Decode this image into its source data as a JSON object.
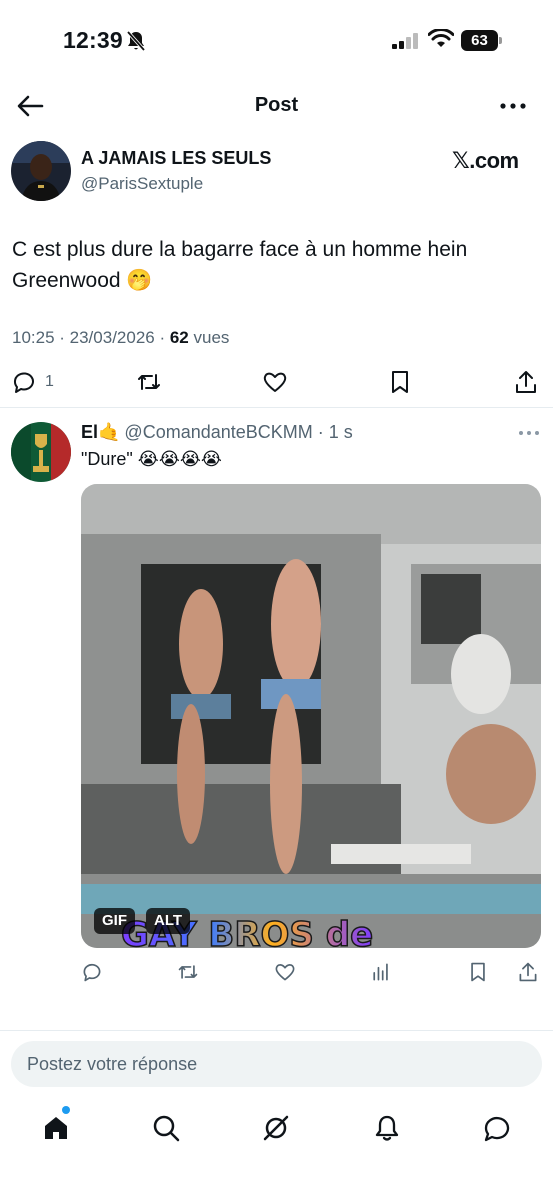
{
  "status_bar": {
    "time": "12:39",
    "battery": "63"
  },
  "header": {
    "title": "Post"
  },
  "post": {
    "author_name": "A JAMAIS LES SEULS",
    "author_handle": "@ParisSextuple",
    "source_badge": "𝕏.com",
    "text": "C est plus dure la bagarre face à un homme hein Greenwood 🤭",
    "time": "10:25 · 23/03/2026 · ",
    "views_count": "62",
    "views_label": " vues",
    "reply_count": "1"
  },
  "reply": {
    "name": "El🤙",
    "handle": "@ComandanteBCKMM · 1 s",
    "text": "\"Dure\" 😭😭😭😭",
    "media_badges": {
      "gif": "GIF",
      "alt": "ALT"
    },
    "media_caption": "GAY BROS de"
  },
  "composer": {
    "placeholder": "Postez votre réponse"
  },
  "icons": {
    "back": "arrow-left-icon",
    "more": "more-horizontal-icon",
    "reply": "comment-icon",
    "repost": "repost-icon",
    "like": "heart-icon",
    "bookmark": "bookmark-icon",
    "share": "share-icon",
    "views": "views-chart-icon",
    "home": "home-icon",
    "search": "search-icon",
    "grok": "grok-icon",
    "notifications": "bell-icon",
    "messages": "chat-icon"
  },
  "colors": {
    "accent": "#1d9bf0",
    "muted": "#536471",
    "text": "#0f1419"
  }
}
